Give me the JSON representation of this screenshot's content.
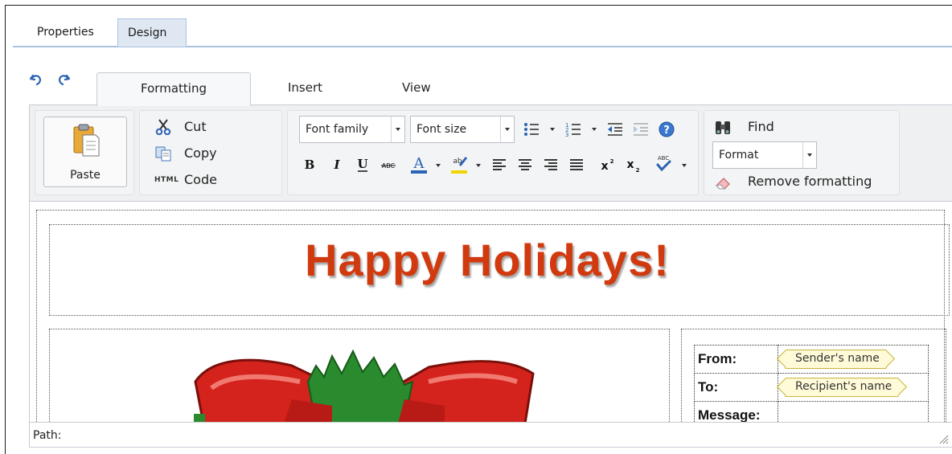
{
  "top_tabs": {
    "properties": "Properties",
    "design": "Design"
  },
  "ribbon_tabs": {
    "formatting": "Formatting",
    "insert": "Insert",
    "view": "View"
  },
  "clipboard": {
    "paste": "Paste",
    "cut": "Cut",
    "copy": "Copy",
    "code": "Code",
    "code_badge": "HTML"
  },
  "font": {
    "family_placeholder": "Font family",
    "size_placeholder": "Font size"
  },
  "tools": {
    "find": "Find",
    "format_select": "Format",
    "remove_formatting": "Remove formatting"
  },
  "document": {
    "headline": "Happy Holidays!",
    "fields": [
      {
        "label": "From:",
        "macro": "Sender's name"
      },
      {
        "label": "To:",
        "macro": "Recipient's name"
      },
      {
        "label": "Message:",
        "macro": ""
      }
    ]
  },
  "path_bar": {
    "label": "Path:"
  },
  "colors": {
    "accent_tab": "#dfe8f2",
    "headline": "#d13a0e",
    "macro_fill": "#fffbd8"
  },
  "icons": [
    "undo-icon",
    "redo-icon",
    "paste-icon",
    "cut-icon",
    "copy-icon",
    "code-icon",
    "bold-icon",
    "italic-icon",
    "underline-icon",
    "strikethrough-icon",
    "font-color-icon",
    "highlight-icon",
    "bulleted-list-icon",
    "numbered-list-icon",
    "outdent-icon",
    "indent-icon",
    "help-icon",
    "align-left-icon",
    "align-center-icon",
    "align-right-icon",
    "justify-icon",
    "superscript-icon",
    "subscript-icon",
    "spellcheck-icon",
    "binoculars-icon",
    "eraser-icon",
    "resize-grip-icon"
  ]
}
